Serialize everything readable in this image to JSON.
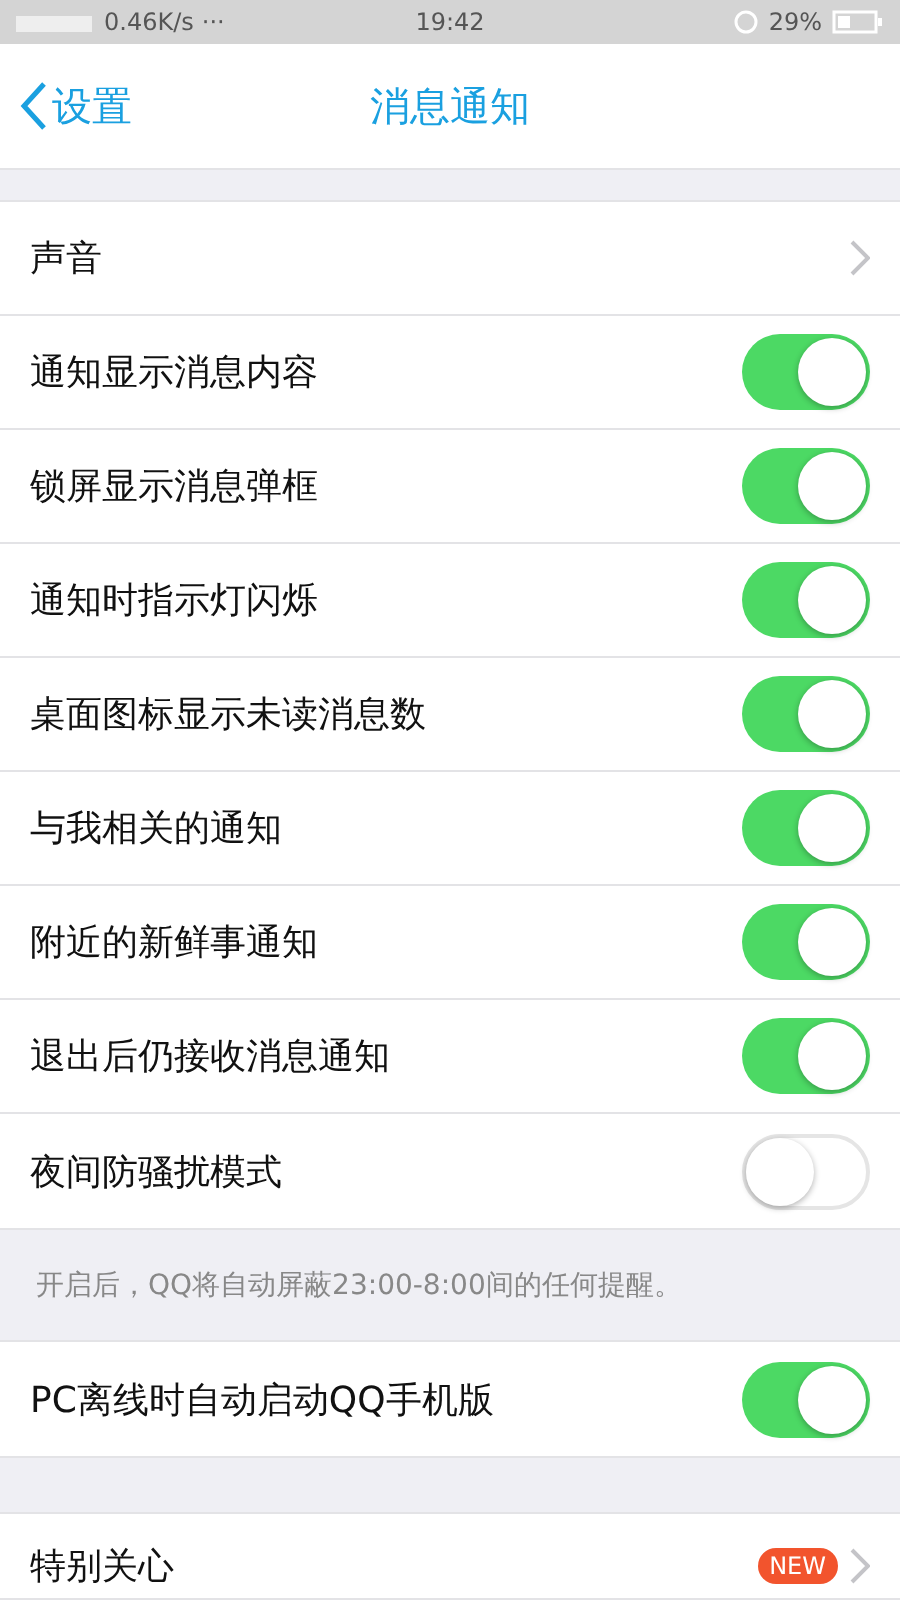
{
  "status_bar": {
    "speed": "0.46K/s",
    "more": "···",
    "time": "19:42",
    "battery": "29%"
  },
  "nav": {
    "back": "设置",
    "title": "消息通知"
  },
  "groups": [
    {
      "rows": [
        {
          "kind": "link",
          "label": "声音"
        },
        {
          "kind": "toggle",
          "label": "通知显示消息内容",
          "on": true
        },
        {
          "kind": "toggle",
          "label": "锁屏显示消息弹框",
          "on": true
        },
        {
          "kind": "toggle",
          "label": "通知时指示灯闪烁",
          "on": true
        },
        {
          "kind": "toggle",
          "label": "桌面图标显示未读消息数",
          "on": true
        },
        {
          "kind": "toggle",
          "label": "与我相关的通知",
          "on": true
        },
        {
          "kind": "toggle",
          "label": "附近的新鲜事通知",
          "on": true
        },
        {
          "kind": "toggle",
          "label": "退出后仍接收消息通知",
          "on": true
        },
        {
          "kind": "toggle",
          "label": "夜间防骚扰模式",
          "on": false
        }
      ],
      "note": "开启后，QQ将自动屏蔽23:00-8:00间的任何提醒。"
    },
    {
      "rows": [
        {
          "kind": "toggle",
          "label": "PC离线时自动启动QQ手机版",
          "on": true
        }
      ]
    },
    {
      "rows": [
        {
          "kind": "link",
          "label": "特别关心",
          "badge": "NEW"
        }
      ]
    }
  ]
}
